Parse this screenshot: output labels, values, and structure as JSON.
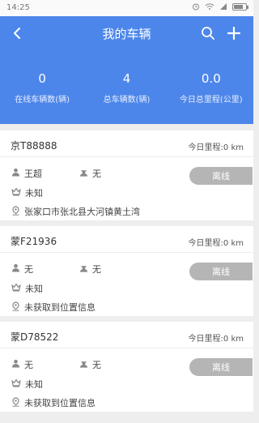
{
  "status_bar": {
    "time": "14:25",
    "battery_level": 0.7
  },
  "header": {
    "title": "我的车辆",
    "color": "#4d86ea",
    "back_icon": "chevron-left-icon",
    "search_icon": "search-icon",
    "add_icon": "plus-icon"
  },
  "stats": [
    {
      "value": "0",
      "label": "在线车辆数(辆)"
    },
    {
      "value": "4",
      "label": "总车辆数(辆)"
    },
    {
      "value": "0.0",
      "label": "今日总里程(公里)"
    }
  ],
  "vehicles": [
    {
      "plate": "京T88888",
      "mileage": "今日里程:0 km",
      "driver": "王超",
      "owner": "无",
      "level": "未知",
      "location": "张家口市张北县大河镇黄土湾",
      "status": "离线"
    },
    {
      "plate": "蒙F21936",
      "mileage": "今日里程:0 km",
      "driver": "无",
      "owner": "无",
      "level": "未知",
      "location": "未获取到位置信息",
      "status": "离线"
    },
    {
      "plate": "蒙D78522",
      "mileage": "今日里程:0 km",
      "driver": "无",
      "owner": "无",
      "level": "未知",
      "location": "未获取到位置信息",
      "status": "离线"
    }
  ]
}
